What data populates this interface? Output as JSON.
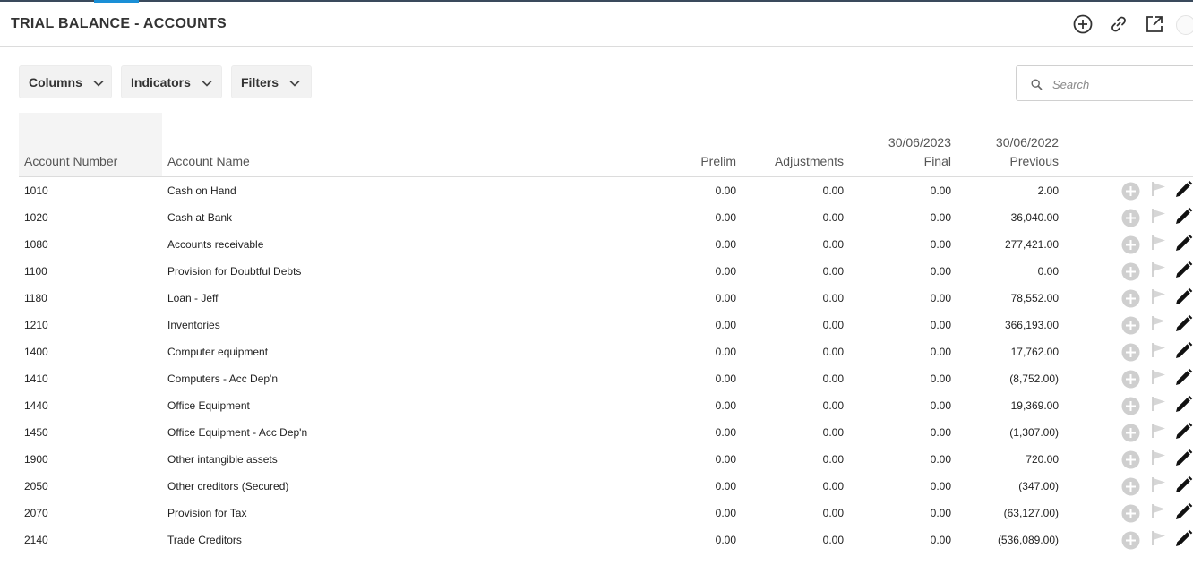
{
  "header": {
    "title": "TRIAL BALANCE - ACCOUNTS",
    "icons": [
      "plus-circle-icon",
      "link-icon",
      "external-link-icon"
    ]
  },
  "toolbar": {
    "columns_label": "Columns",
    "indicators_label": "Indicators",
    "filters_label": "Filters",
    "search_placeholder": "Search"
  },
  "table": {
    "headers": {
      "account_number": "Account Number",
      "account_name": "Account Name",
      "prelim": "Prelim",
      "adjustments": "Adjustments",
      "final_date": "30/06/2023",
      "final": "Final",
      "previous_date": "30/06/2022",
      "previous": "Previous"
    },
    "rows": [
      {
        "number": "1010",
        "name": "Cash on Hand",
        "prelim": "0.00",
        "adjustments": "0.00",
        "final": "0.00",
        "previous": "2.00"
      },
      {
        "number": "1020",
        "name": "Cash at Bank",
        "prelim": "0.00",
        "adjustments": "0.00",
        "final": "0.00",
        "previous": "36,040.00"
      },
      {
        "number": "1080",
        "name": "Accounts receivable",
        "prelim": "0.00",
        "adjustments": "0.00",
        "final": "0.00",
        "previous": "277,421.00"
      },
      {
        "number": "1100",
        "name": "Provision for Doubtful Debts",
        "prelim": "0.00",
        "adjustments": "0.00",
        "final": "0.00",
        "previous": "0.00"
      },
      {
        "number": "1180",
        "name": "Loan - Jeff",
        "prelim": "0.00",
        "adjustments": "0.00",
        "final": "0.00",
        "previous": "78,552.00"
      },
      {
        "number": "1210",
        "name": "Inventories",
        "prelim": "0.00",
        "adjustments": "0.00",
        "final": "0.00",
        "previous": "366,193.00"
      },
      {
        "number": "1400",
        "name": "Computer equipment",
        "prelim": "0.00",
        "adjustments": "0.00",
        "final": "0.00",
        "previous": "17,762.00"
      },
      {
        "number": "1410",
        "name": "Computers - Acc Dep'n",
        "prelim": "0.00",
        "adjustments": "0.00",
        "final": "0.00",
        "previous": "(8,752.00)"
      },
      {
        "number": "1440",
        "name": "Office Equipment",
        "prelim": "0.00",
        "adjustments": "0.00",
        "final": "0.00",
        "previous": "19,369.00"
      },
      {
        "number": "1450",
        "name": "Office Equipment - Acc Dep'n",
        "prelim": "0.00",
        "adjustments": "0.00",
        "final": "0.00",
        "previous": "(1,307.00)"
      },
      {
        "number": "1900",
        "name": "Other intangible assets",
        "prelim": "0.00",
        "adjustments": "0.00",
        "final": "0.00",
        "previous": "720.00"
      },
      {
        "number": "2050",
        "name": "Other creditors (Secured)",
        "prelim": "0.00",
        "adjustments": "0.00",
        "final": "0.00",
        "previous": "(347.00)"
      },
      {
        "number": "2070",
        "name": "Provision for Tax",
        "prelim": "0.00",
        "adjustments": "0.00",
        "final": "0.00",
        "previous": "(63,127.00)"
      },
      {
        "number": "2140",
        "name": "Trade Creditors",
        "prelim": "0.00",
        "adjustments": "0.00",
        "final": "0.00",
        "previous": "(536,089.00)"
      }
    ],
    "row_actions": [
      "add-circle-icon",
      "flag-icon",
      "pencil-icon"
    ]
  },
  "colors": {
    "title_text": "#333333",
    "header_text": "#555555",
    "toolbar_bg": "#f2f2f2",
    "accent": "#1a8fd6",
    "action_gray": "#c8c8c8"
  }
}
